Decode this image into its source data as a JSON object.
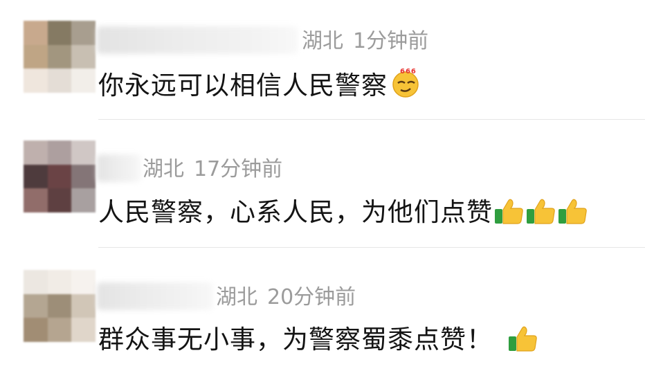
{
  "comments": [
    {
      "location": "湖北",
      "time": "1分钟前",
      "text": "你永远可以相信人民警察",
      "emoji": "666-smirk-emoji",
      "avatar_colors": [
        "#c8a98d",
        "#857a63",
        "#a89e8f",
        "#bfa585",
        "#a2967f",
        "#c8bfb2",
        "#efe6dd",
        "#e4ddd6",
        "#f2eee9"
      ]
    },
    {
      "location": "湖北",
      "time": "17分钟前",
      "text": "人民警察，心系人民，为他们点赞",
      "emoji": "thumbs-up-emoji",
      "avatar_colors": [
        "#bfb0ad",
        "#ad9f9f",
        "#d0c7c5",
        "#4e3b3d",
        "#6a4345",
        "#847577",
        "#916d6a",
        "#5e4041",
        "#a8a0a0"
      ]
    },
    {
      "location": "湖北",
      "time": "20分钟前",
      "text": "群众事无小事，为警察蜀黍点赞！",
      "emoji": "thumbs-up-emoji",
      "avatar_colors": [
        "#ece7e1",
        "#f1ece6",
        "#f6f2ee",
        "#b4a692",
        "#9d8e78",
        "#d1c6b7",
        "#a18d74",
        "#b5a590",
        "#e0d6ca"
      ]
    }
  ],
  "colors": {
    "meta_text": "#9b9b9b",
    "body_text": "#141414",
    "divider": "#e6e6e6"
  }
}
